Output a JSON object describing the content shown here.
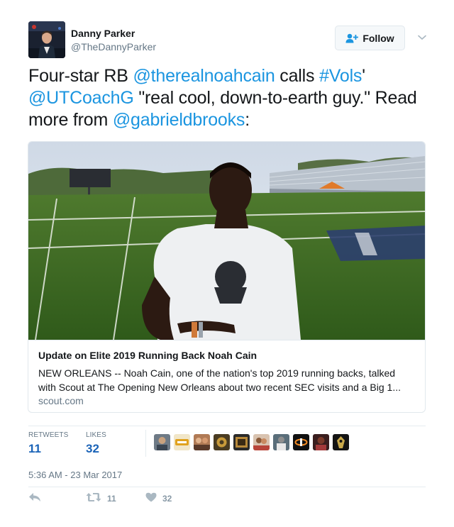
{
  "user": {
    "name": "Danny Parker",
    "handle": "@TheDannyParker"
  },
  "follow_button": {
    "label": "Follow"
  },
  "tweet": {
    "text_parts": [
      {
        "text": "Four-star RB ",
        "link": false
      },
      {
        "text": "@therealnoahcain",
        "link": true
      },
      {
        "text": " calls ",
        "link": false
      },
      {
        "text": "#Vols",
        "link": true
      },
      {
        "text": "' ",
        "link": false
      },
      {
        "text": "@UTCoachG",
        "link": true
      },
      {
        "text": " \"real cool, down-to-earth guy.\" Read more from ",
        "link": false
      },
      {
        "text": "@gabrieldbrooks",
        "link": true
      },
      {
        "text": ":",
        "link": false
      }
    ]
  },
  "card": {
    "title": "Update on Elite 2019 Running Back Noah Cain",
    "description_line1": "NEW ORLEANS -- Noah Cain, one of the nation's top 2019 running backs, talked",
    "description_line2": "with Scout at The Opening New Orleans about two recent SEC visits and a Big 1...",
    "domain": "scout.com"
  },
  "stats": {
    "retweets_label": "RETWEETS",
    "retweets_value": "11",
    "likes_label": "LIKES",
    "likes_value": "32"
  },
  "likers": [
    "liker-avatar",
    "liker-avatar",
    "liker-avatar",
    "liker-avatar",
    "liker-avatar",
    "liker-avatar",
    "liker-avatar",
    "liker-avatar",
    "liker-avatar",
    "liker-avatar"
  ],
  "timestamp": "5:36 AM - 23 Mar 2017",
  "actions": {
    "reply_icon": "reply-icon",
    "retweet_icon": "retweet-icon",
    "retweet_count": "11",
    "like_icon": "heart-icon",
    "like_count": "32"
  },
  "colors": {
    "link": "#1b95e0",
    "stat_value": "#1b64b8",
    "muted": "#657786",
    "border": "#e1e8ed"
  }
}
